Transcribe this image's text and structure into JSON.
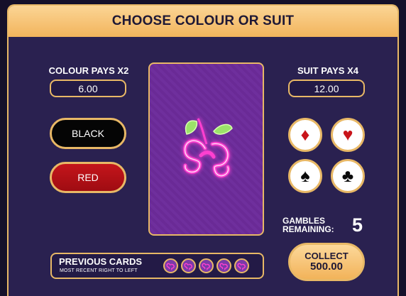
{
  "header": {
    "title": "CHOOSE COLOUR OR SUIT"
  },
  "colour": {
    "label": "COLOUR PAYS X2",
    "value": "6.00"
  },
  "suit": {
    "label": "SUIT PAYS X4",
    "value": "12.00"
  },
  "buttons": {
    "black": "BLACK",
    "red": "RED"
  },
  "suits": [
    {
      "name": "diamond",
      "glyph": "♦",
      "color": "#c8141a"
    },
    {
      "name": "heart",
      "glyph": "♥",
      "color": "#c8141a"
    },
    {
      "name": "spade",
      "glyph": "♠",
      "color": "#0a0a0a"
    },
    {
      "name": "club",
      "glyph": "♣",
      "color": "#0a0a0a"
    }
  ],
  "gambles": {
    "label_line1": "GAMBLES",
    "label_line2": "REMAINING:",
    "value": "5"
  },
  "collect": {
    "label": "COLLECT",
    "amount": "500.00"
  },
  "previous": {
    "title": "PREVIOUS CARDS",
    "subtitle": "MOST RECENT RIGHT TO LEFT",
    "count": 5
  },
  "theme": {
    "panel": "#2a2150",
    "gold": "#e8b866",
    "header": "#f2b45c",
    "card_back": "#6a2a96",
    "neon_pink": "#ff3fd0",
    "leaf_green": "#9be26a"
  },
  "icons": [
    "berry-logo-icon",
    "diamond-icon",
    "heart-icon",
    "spade-icon",
    "club-icon"
  ]
}
